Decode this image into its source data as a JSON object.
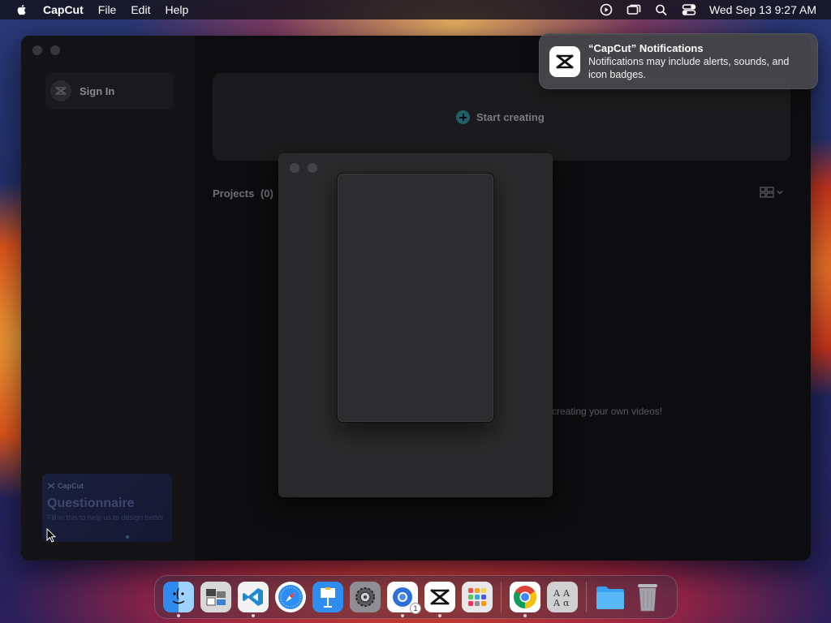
{
  "menubar": {
    "app_name": "CapCut",
    "menus": [
      "File",
      "Edit",
      "Help"
    ],
    "clock": "Wed Sep 13  9:27 AM",
    "status_icons": [
      "screen-record-icon",
      "display-icon",
      "search-icon",
      "control-center-icon"
    ]
  },
  "sidebar": {
    "signin_label": "Sign In",
    "questionnaire": {
      "brand": "CapCut",
      "title": "Questionnaire",
      "subtitle": "Fill in this to help us to design better"
    }
  },
  "main": {
    "start_label": "Start creating",
    "projects_label": "Projects",
    "projects_count": "(0)",
    "empty_hint": "creating your own videos!"
  },
  "notification": {
    "title": "“CapCut” Notifications",
    "body": "Notifications may include alerts, sounds, and icon badges."
  },
  "dock": {
    "items": [
      {
        "name": "finder",
        "running": true
      },
      {
        "name": "preview",
        "running": false
      },
      {
        "name": "vscode",
        "running": true
      },
      {
        "name": "safari",
        "running": false
      },
      {
        "name": "keynote",
        "running": false
      },
      {
        "name": "system-settings",
        "running": false
      },
      {
        "name": "chrome-canary",
        "running": true,
        "badge": "1"
      },
      {
        "name": "capcut",
        "running": true
      },
      {
        "name": "launchpad",
        "running": false
      },
      {
        "name": "chrome",
        "running": true
      },
      {
        "name": "font-book",
        "running": false
      },
      {
        "name": "downloads-folder",
        "running": false
      },
      {
        "name": "trash",
        "running": false
      }
    ]
  },
  "colors": {
    "accent_teal": "#1f5f68",
    "window_bg": "#0d0d0f",
    "notification_bg": "#48484c"
  }
}
